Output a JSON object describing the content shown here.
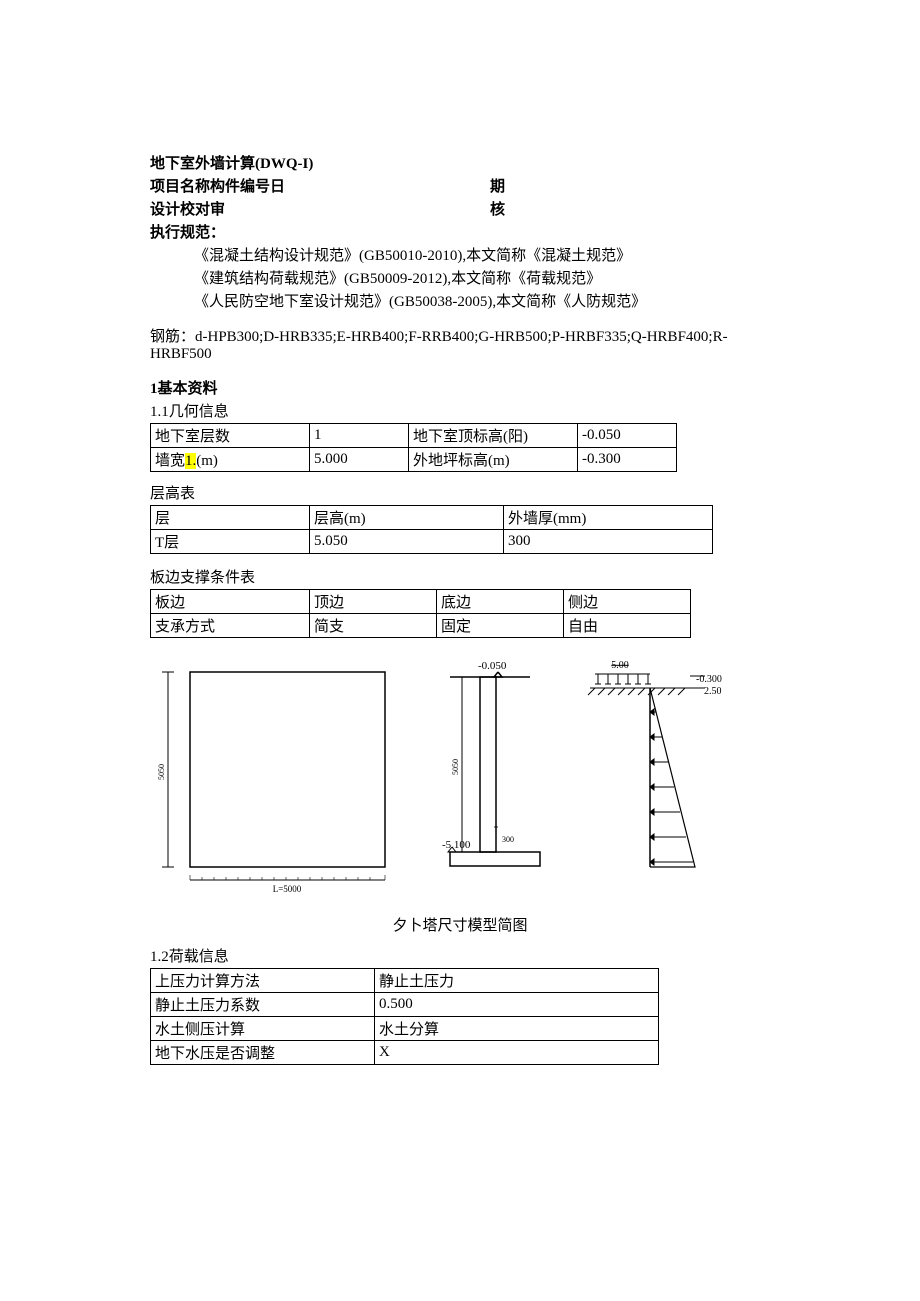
{
  "header": {
    "title": "地下室外墙计算(DWQ-I)",
    "row1_left": "项目名称构件编号日",
    "row1_right": "期",
    "row2_left": "设计校对审",
    "row2_right": "核",
    "spec_title": "执行规范：",
    "specs": [
      "《混凝土结构设计规范》(GB50010-2010),本文简称《混凝土规范》",
      "《建筑结构荷载规范》(GB50009-2012),本文简称《荷载规范》",
      "《人民防空地下室设计规范》(GB50038-2005),本文简称《人防规范》"
    ],
    "rebar": "钢筋：d-HPB300;D-HRB335;E-HRB400;F-RRB400;G-HRB500;P-HRBF335;Q-HRBF400;R-HRBF500"
  },
  "s1": {
    "title": "1基本资料",
    "s11": "1.1几何信息",
    "geom": {
      "r1c1": "地下室层数",
      "r1c2": "1",
      "r1c3": "地下室顶标高(阳)",
      "r1c4": "-0.050",
      "r2c1a": "墙宽",
      "r2c1b": "1.",
      "r2c1c": "(m)",
      "r2c2": "5.000",
      "r2c3": "外地坪标高(m)",
      "r2c4": "-0.300"
    },
    "storey_title": "层高表",
    "storey": {
      "h1": "层",
      "h2": "层高(m)",
      "h3": "外墙厚(mm)",
      "r1c1": "T层",
      "r1c2": "5.050",
      "r1c3": "300"
    },
    "support_title": "板边支撑条件表",
    "support": {
      "h1": "板边",
      "h2": "顶边",
      "h3": "底边",
      "h4": "侧边",
      "r1": "支承方式",
      "r2": "简支",
      "r3": "固定",
      "r4": "自由"
    },
    "fig": {
      "h_dim": "5050",
      "w_dim": "L=5000",
      "top_lvl": "-0.050",
      "bot_lvl": "-5.100",
      "v_dim": "5050",
      "thk": "300",
      "load_top": "5.00",
      "load_right_a": "-0.300",
      "load_right_b": "2.50",
      "caption": "夕卜塔尺寸模型简图"
    },
    "s12": "1.2荷载信息",
    "load": {
      "r1a": "上压力计算方法",
      "r1b": "静止土压力",
      "r2a": "静止土压力系数",
      "r2b": "0.500",
      "r3a": "水土侧压计算",
      "r3b": "水土分算",
      "r4a": "地下水压是否调整",
      "r4b": "X"
    }
  }
}
